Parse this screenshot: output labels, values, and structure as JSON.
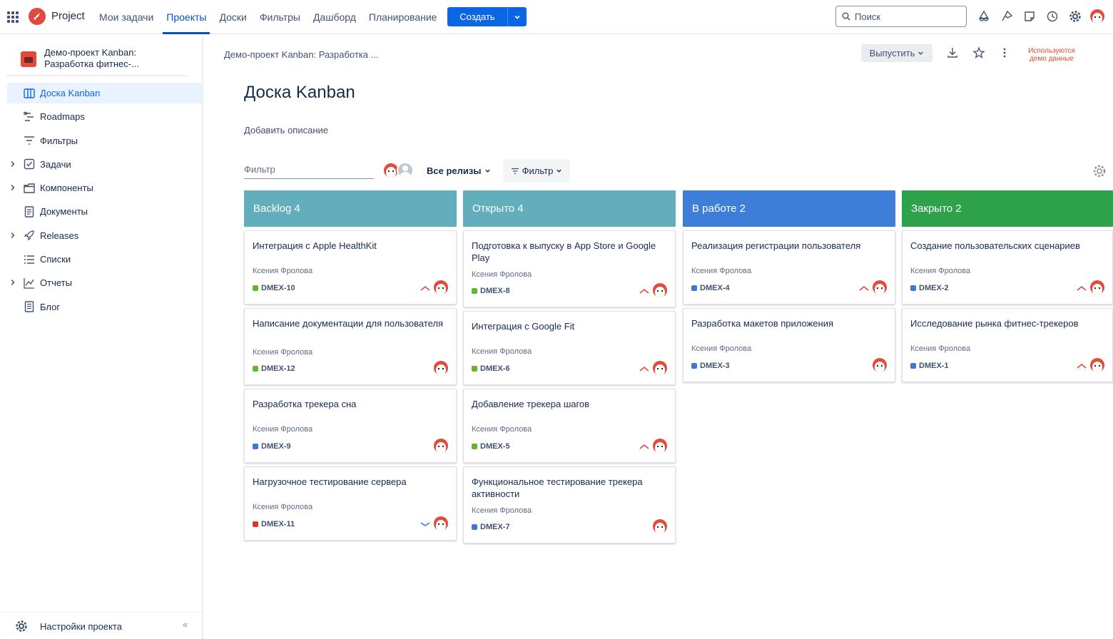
{
  "topnav": {
    "app_title": "Project",
    "items": [
      {
        "label": "Мои задачи",
        "active": false
      },
      {
        "label": "Проекты",
        "active": true
      },
      {
        "label": "Доски",
        "active": false
      },
      {
        "label": "Фильтры",
        "active": false
      },
      {
        "label": "Дашборд",
        "active": false
      },
      {
        "label": "Планирование",
        "active": false
      }
    ],
    "create_label": "Создать",
    "search_placeholder": "Поиск"
  },
  "sidebar": {
    "project_name": "Демо-проект Kanban: Разработка фитнес-...",
    "items": [
      {
        "label": "Доска Kanban",
        "icon": "board-icon",
        "active": true,
        "expandable": false
      },
      {
        "label": "Roadmaps",
        "icon": "roadmap-icon",
        "active": false,
        "expandable": false
      },
      {
        "label": "Фильтры",
        "icon": "filter-icon",
        "active": false,
        "expandable": false
      },
      {
        "label": "Задачи",
        "icon": "checkbox-icon",
        "active": false,
        "expandable": true
      },
      {
        "label": "Компоненты",
        "icon": "folder-icon",
        "active": false,
        "expandable": true
      },
      {
        "label": "Документы",
        "icon": "document-icon",
        "active": false,
        "expandable": false
      },
      {
        "label": "Releases",
        "icon": "rocket-icon",
        "active": false,
        "expandable": true
      },
      {
        "label": "Списки",
        "icon": "list-icon",
        "active": false,
        "expandable": false
      },
      {
        "label": "Отчеты",
        "icon": "chart-icon",
        "active": false,
        "expandable": true
      },
      {
        "label": "Блог",
        "icon": "blog-icon",
        "active": false,
        "expandable": false
      }
    ],
    "settings_label": "Настройки проекта",
    "collapse_glyph": "«"
  },
  "header": {
    "breadcrumb": "Демо-проект Kanban: Разработка ...",
    "release_label": "Выпустить",
    "demo_note": "Используются демо данные",
    "title": "Доска Kanban",
    "add_description": "Добавить описание"
  },
  "toolbar": {
    "filter_placeholder": "Фильтр",
    "releases_label": "Все релизы",
    "filter_label": "Фильтр"
  },
  "colors": {
    "green": "#62b52e",
    "blue": "#3d78d8",
    "red": "#d8392f"
  },
  "columns": [
    {
      "title": "Backlog 4",
      "color": "#63aebc",
      "cards": [
        {
          "title": "Интеграция с Apple HealthKit",
          "assignee": "Ксения Фролова",
          "key": "DMEX-10",
          "type_color": "#62b52e",
          "priority": "high"
        },
        {
          "title": "Написание документации для пользователя",
          "assignee": "Ксения Фролова",
          "key": "DMEX-12",
          "type_color": "#62b52e",
          "priority": "none"
        },
        {
          "title": "Разработка трекера сна",
          "assignee": "Ксения Фролова",
          "key": "DMEX-9",
          "type_color": "#3d78d8",
          "priority": "none"
        },
        {
          "title": "Нагрузочное тестирование сервера",
          "assignee": "Ксения Фролова",
          "key": "DMEX-11",
          "type_color": "#d8392f",
          "priority": "low"
        }
      ]
    },
    {
      "title": "Открыто 4",
      "color": "#63aebc",
      "cards": [
        {
          "title": "Подготовка к выпуску в App Store и Google Play",
          "assignee": "Ксения Фролова",
          "key": "DMEX-8",
          "type_color": "#62b52e",
          "priority": "high"
        },
        {
          "title": "Интеграция с Google Fit",
          "assignee": "Ксения Фролова",
          "key": "DMEX-6",
          "type_color": "#62b52e",
          "priority": "high"
        },
        {
          "title": "Добавление трекера шагов",
          "assignee": "Ксения Фролова",
          "key": "DMEX-5",
          "type_color": "#62b52e",
          "priority": "high"
        },
        {
          "title": "Функциональное тестирование трекера активности",
          "assignee": "Ксения Фролова",
          "key": "DMEX-7",
          "type_color": "#3d78d8",
          "priority": "none"
        }
      ]
    },
    {
      "title": "В работе 2",
      "color": "#3d7fd8",
      "cards": [
        {
          "title": "Реализация регистрации пользователя",
          "assignee": "Ксения Фролова",
          "key": "DMEX-4",
          "type_color": "#3d78d8",
          "priority": "high"
        },
        {
          "title": "Разработка макетов приложения",
          "assignee": "Ксения Фролова",
          "key": "DMEX-3",
          "type_color": "#3d78d8",
          "priority": "none"
        }
      ]
    },
    {
      "title": "Закрыто 2",
      "color": "#2ea24a",
      "cards": [
        {
          "title": "Создание пользовательских сценариев",
          "assignee": "Ксения Фролова",
          "key": "DMEX-2",
          "type_color": "#3d78d8",
          "priority": "high"
        },
        {
          "title": "Исследование рынка фитнес-трекеров",
          "assignee": "Ксения Фролова",
          "key": "DMEX-1",
          "type_color": "#3d78d8",
          "priority": "high"
        }
      ]
    }
  ]
}
